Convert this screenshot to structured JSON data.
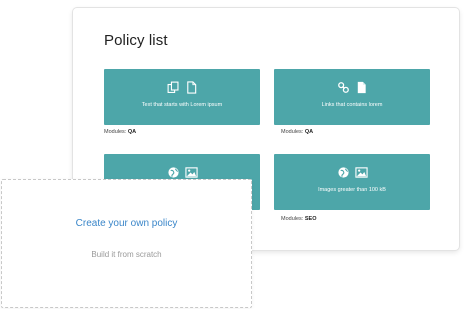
{
  "panel": {
    "title": "Policy list"
  },
  "cards": [
    {
      "icons": [
        "copy-icon",
        "file-icon"
      ],
      "label": "Text that starts with Lorem ipsum",
      "modules_label": "Modules:",
      "modules_value": "QA"
    },
    {
      "icons": [
        "link-icon",
        "file-filled-icon"
      ],
      "label": "Links that contains lorem",
      "modules_label": "Modules:",
      "modules_value": "QA"
    },
    {
      "icons": [
        "globe-icon",
        "image-icon"
      ],
      "label": "",
      "modules_label": "",
      "modules_value": ""
    },
    {
      "icons": [
        "globe-icon",
        "image-icon"
      ],
      "label": "Images greater than 100 kB",
      "modules_label": "Modules:",
      "modules_value": "SEO"
    }
  ],
  "create": {
    "title": "Create your own policy",
    "subtitle": "Build it from scratch"
  },
  "colors": {
    "card_bg": "#4da6a9",
    "link_blue": "#3a86c9",
    "muted_text": "#9a9a9a"
  }
}
